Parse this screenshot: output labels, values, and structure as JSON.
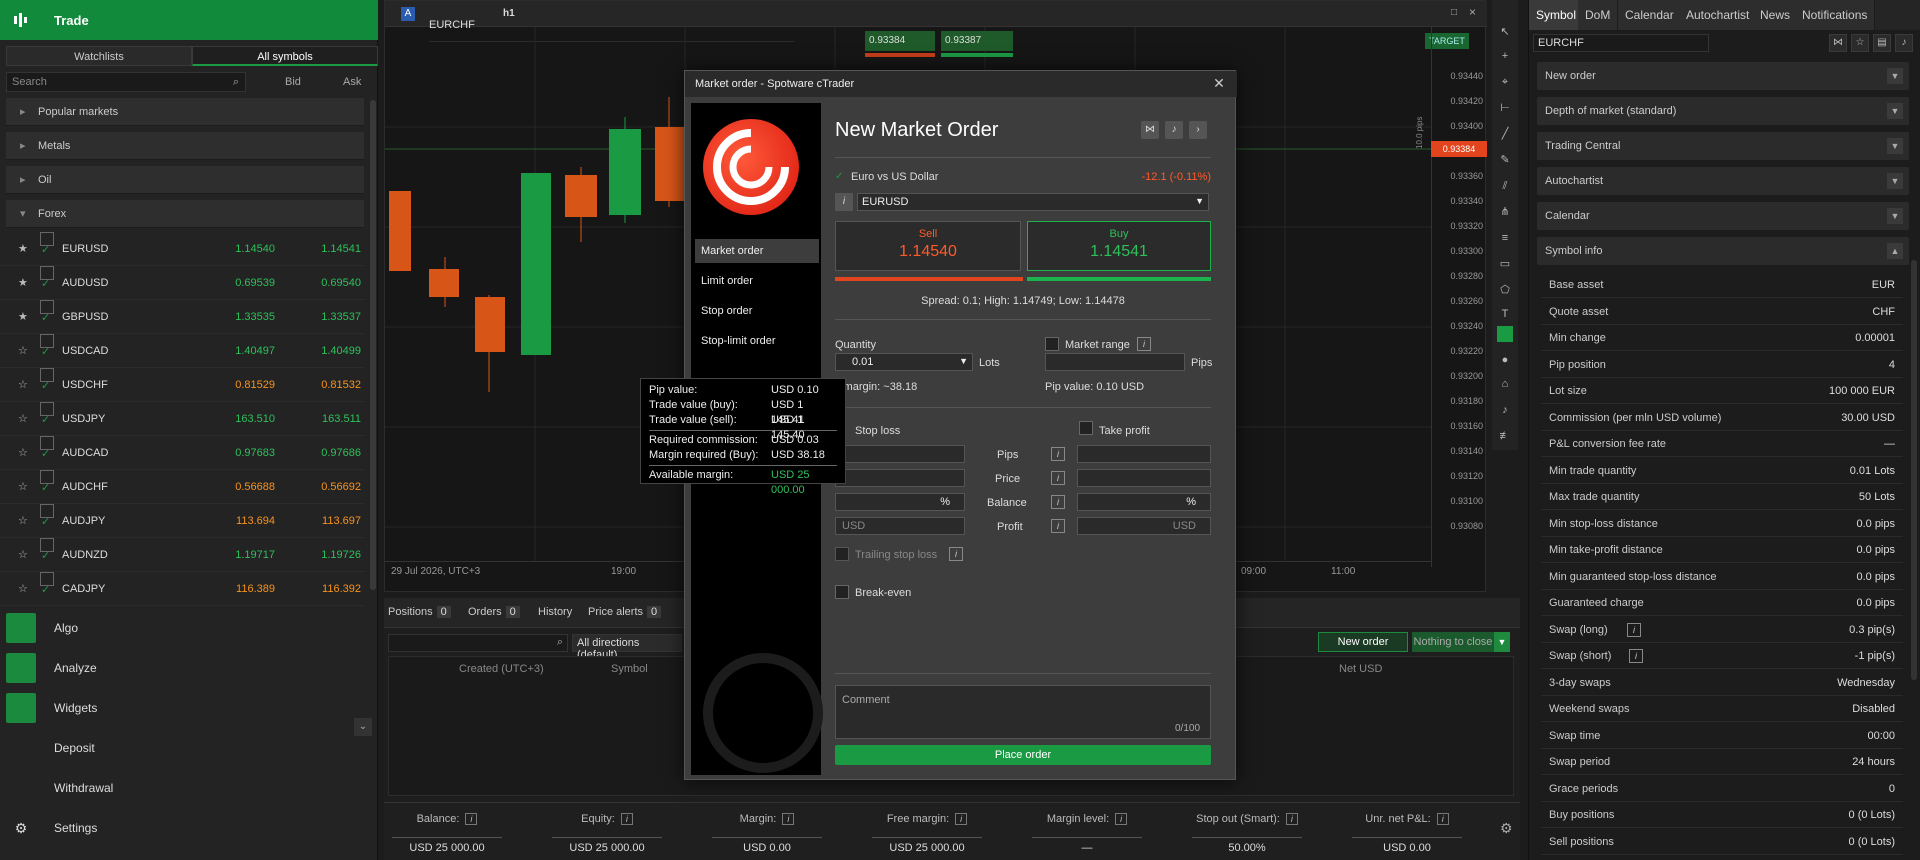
{
  "left": {
    "trade_label": "Trade",
    "tabs": [
      "Watchlists",
      "All symbols"
    ],
    "search_placeholder": "Search",
    "col_bid": "Bid",
    "col_ask": "Ask",
    "categories": [
      "Popular markets",
      "Metals",
      "Oil",
      "Forex"
    ],
    "symbols": [
      {
        "name": "EURUSD",
        "bid": "1.14540",
        "ask": "1.14541",
        "starred": true
      },
      {
        "name": "AUDUSD",
        "bid": "0.69539",
        "ask": "0.69540",
        "starred": true
      },
      {
        "name": "GBPUSD",
        "bid": "1.33535",
        "ask": "1.33537",
        "starred": true
      },
      {
        "name": "USDCAD",
        "bid": "1.40497",
        "ask": "1.40499",
        "starred": false
      },
      {
        "name": "USDCHF",
        "bid": "0.81529",
        "ask": "0.81532",
        "starred": false
      },
      {
        "name": "USDJPY",
        "bid": "163.510",
        "ask": "163.511",
        "starred": false
      },
      {
        "name": "AUDCAD",
        "bid": "0.97683",
        "ask": "0.97686",
        "starred": false
      },
      {
        "name": "AUDCHF",
        "bid": "0.56688",
        "ask": "0.56692",
        "starred": false
      },
      {
        "name": "AUDJPY",
        "bid": "113.694",
        "ask": "113.697",
        "starred": false
      },
      {
        "name": "AUDNZD",
        "bid": "1.19717",
        "ask": "1.19726",
        "starred": false
      },
      {
        "name": "CADJPY",
        "bid": "116.389",
        "ask": "116.392",
        "starred": false
      }
    ],
    "nav": [
      "Algo",
      "Analyze",
      "Widgets",
      "Deposit",
      "Withdrawal",
      "Settings"
    ]
  },
  "chart": {
    "symbol": "EURCHF",
    "badge": "A",
    "timeframe": "h1",
    "quote_sell": "0.93384",
    "quote_buy": "0.93387",
    "target": "TARGET",
    "current_price": "0.93384",
    "pip_label": "10.0 pips",
    "price_ticks": [
      "0.93440",
      "0.93420",
      "0.93400",
      "0.93380",
      "0.93360",
      "0.93340",
      "0.93320",
      "0.93300",
      "0.93280",
      "0.93260",
      "0.93240",
      "0.93220",
      "0.93200",
      "0.93180",
      "0.93160",
      "0.93140",
      "0.93120",
      "0.93100",
      "0.93080"
    ],
    "time_labels": [
      "29 Jul 2026, UTC+3",
      "19:00",
      "09:00",
      "11:00"
    ]
  },
  "bottom": {
    "tabs": [
      {
        "label": "Positions",
        "count": "0"
      },
      {
        "label": "Orders",
        "count": "0"
      },
      {
        "label": "History",
        "count": null
      },
      {
        "label": "Price alerts",
        "count": "0"
      }
    ],
    "direction": "All directions (default)",
    "new_order": "New order",
    "nothing_to_close": "Nothing to close",
    "headers": [
      "Created (UTC+3)",
      "Symbol",
      "Net USD"
    ],
    "account": [
      {
        "label": "Balance:",
        "value": "USD 25 000.00"
      },
      {
        "label": "Equity:",
        "value": "USD 25 000.00"
      },
      {
        "label": "Margin:",
        "value": "USD 0.00"
      },
      {
        "label": "Free margin:",
        "value": "USD 25 000.00"
      },
      {
        "label": "Margin level:",
        "value": "—"
      },
      {
        "label": "Stop out (Smart):",
        "value": "50.00%"
      },
      {
        "label": "Unr. net P&L:",
        "value": "USD 0.00"
      }
    ]
  },
  "right": {
    "tabs": [
      "Symbol",
      "DoM",
      "Calendar",
      "Autochartist",
      "News",
      "Notifications"
    ],
    "symbol": "EURCHF",
    "sections": [
      "New order",
      "Depth of market (standard)",
      "Trading Central",
      "Autochartist",
      "Calendar",
      "Symbol info"
    ],
    "info": [
      {
        "k": "Base asset",
        "v": "EUR"
      },
      {
        "k": "Quote asset",
        "v": "CHF"
      },
      {
        "k": "Min change",
        "v": "0.00001"
      },
      {
        "k": "Pip position",
        "v": "4"
      },
      {
        "k": "Lot size",
        "v": "100 000 EUR"
      },
      {
        "k": "Commission (per mln USD volume)",
        "v": "30.00 USD"
      },
      {
        "k": "P&L conversion fee rate",
        "v": "—"
      },
      {
        "k": "Min trade quantity",
        "v": "0.01 Lots"
      },
      {
        "k": "Max trade quantity",
        "v": "50 Lots"
      },
      {
        "k": "Min stop-loss distance",
        "v": "0.0 pips"
      },
      {
        "k": "Min take-profit distance",
        "v": "0.0 pips"
      },
      {
        "k": "Min guaranteed stop-loss distance",
        "v": "0.0 pips"
      },
      {
        "k": "Guaranteed charge",
        "v": "0.0 pips"
      },
      {
        "k": "Swap (long)",
        "v": "0.3 pip(s)"
      },
      {
        "k": "Swap (short)",
        "v": "-1 pip(s)"
      },
      {
        "k": "3-day swaps",
        "v": "Wednesday"
      },
      {
        "k": "Weekend swaps",
        "v": "Disabled"
      },
      {
        "k": "Swap time",
        "v": "00:00"
      },
      {
        "k": "Swap period",
        "v": "24 hours"
      },
      {
        "k": "Grace periods",
        "v": "0"
      },
      {
        "k": "Buy positions",
        "v": "0  (0 Lots)"
      },
      {
        "k": "Sell positions",
        "v": "0  (0 Lots)"
      }
    ]
  },
  "modal": {
    "window_title": "Market order - Spotware cTrader",
    "title": "New Market Order",
    "order_types": [
      "Market order",
      "Limit order",
      "Stop order",
      "Stop-limit order"
    ],
    "instrument_name": "Euro vs US Dollar",
    "instrument_change": "-12.1 (-0.11%)",
    "instrument": "EURUSD",
    "sell_label": "Sell",
    "sell_price": "1.14540",
    "buy_label": "Buy",
    "buy_price": "1.14541",
    "spread": "Spread: 0.1; High: 1.14749; Low: 1.14478",
    "quantity_label": "Quantity",
    "quantity": "0.01",
    "lots": "Lots",
    "margin_text": "y margin: ~38.18",
    "market_range": "Market range",
    "pips": "Pips",
    "pip_value": "Pip value: 0.10 USD",
    "stop_loss": "Stop loss",
    "take_profit": "Take profit",
    "row_labels": [
      "Pips",
      "Price",
      "Balance",
      "Profit"
    ],
    "pct": "%",
    "usd": "USD",
    "trailing": "Trailing stop loss",
    "break_even": "Break-even",
    "comment_placeholder": "Comment",
    "comment_count": "0/100",
    "place_order": "Place order"
  },
  "tooltip": [
    {
      "k": "Pip value:",
      "v": "USD 0.10"
    },
    {
      "k": "Trade value (buy):",
      "v": "USD 1 145.41"
    },
    {
      "k": "Trade value (sell):",
      "v": "USD 1 145.40"
    },
    {
      "k": "Required commission:",
      "v": "USD 0.03"
    },
    {
      "k": "Margin required (Buy):",
      "v": "USD 38.18"
    },
    {
      "k": "Available margin:",
      "v": "USD 25 000.00"
    }
  ]
}
